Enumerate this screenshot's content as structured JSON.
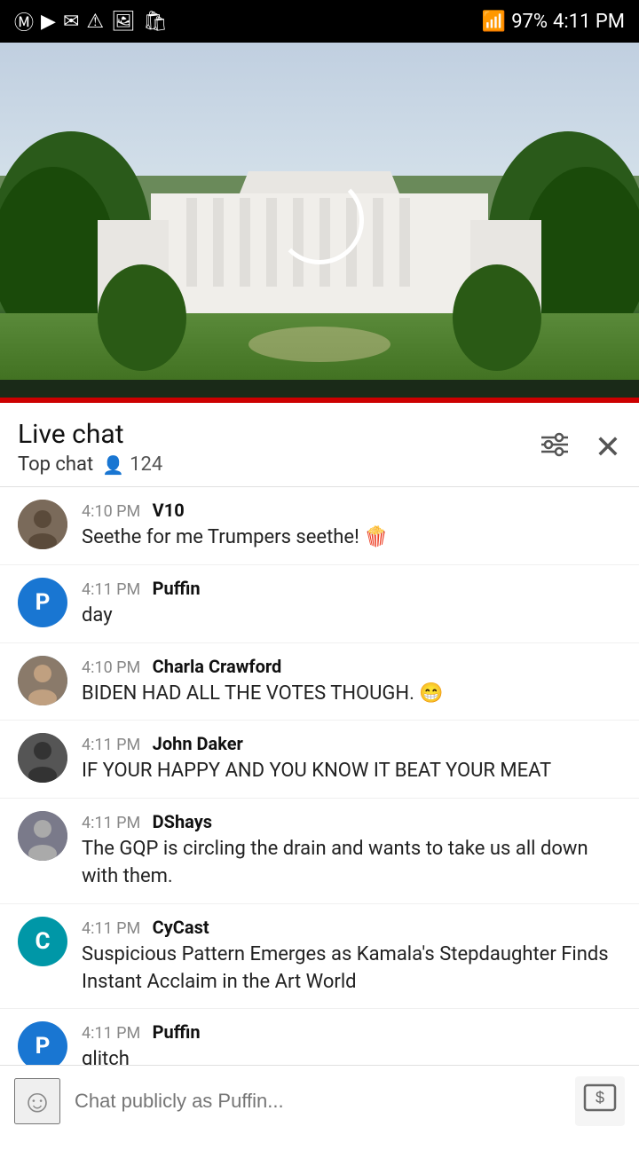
{
  "status_bar": {
    "time": "4:11 PM",
    "battery": "97%",
    "icons_left": [
      "m-icon",
      "youtube-icon",
      "gmail-icon",
      "warning-icon",
      "image-icon",
      "bag-icon"
    ],
    "icons_right": [
      "wifi-icon",
      "signal-icon",
      "battery-icon"
    ]
  },
  "video": {
    "spinner_visible": true
  },
  "live_chat": {
    "title": "Live chat",
    "top_chat_label": "Top chat",
    "viewer_count": "124",
    "filter_label": "filter-icon",
    "close_label": "close-icon"
  },
  "messages": [
    {
      "id": 1,
      "time": "4:10 PM",
      "username": "V10",
      "text": "Seethe for me Trumpers seethe! 🍿",
      "avatar_type": "photo1",
      "avatar_letter": ""
    },
    {
      "id": 2,
      "time": "4:11 PM",
      "username": "Puffin",
      "text": "day",
      "avatar_type": "blue",
      "avatar_letter": "P"
    },
    {
      "id": 3,
      "time": "4:10 PM",
      "username": "Charla Crawford",
      "text": "BIDEN HAD ALL THE VOTES THOUGH. 😁",
      "avatar_type": "photo2",
      "avatar_letter": ""
    },
    {
      "id": 4,
      "time": "4:11 PM",
      "username": "John Daker",
      "text": "IF YOUR HAPPY AND YOU KNOW IT BEAT YOUR MEAT",
      "avatar_type": "dark",
      "avatar_letter": ""
    },
    {
      "id": 5,
      "time": "4:11 PM",
      "username": "DShays",
      "text": "The GQP is circling the drain and wants to take us all down with them.",
      "avatar_type": "photo3",
      "avatar_letter": ""
    },
    {
      "id": 6,
      "time": "4:11 PM",
      "username": "CyCast",
      "text": "Suspicious Pattern Emerges as Kamala's Stepdaughter Finds Instant Acclaim in the Art World",
      "avatar_type": "cyan",
      "avatar_letter": "C"
    },
    {
      "id": 7,
      "time": "4:11 PM",
      "username": "Puffin",
      "text": "glitch",
      "avatar_type": "blue",
      "avatar_letter": "P"
    }
  ],
  "input_bar": {
    "placeholder": "Chat publicly as Puffin...",
    "emoji_icon": "☺",
    "send_icon": "⊞"
  }
}
